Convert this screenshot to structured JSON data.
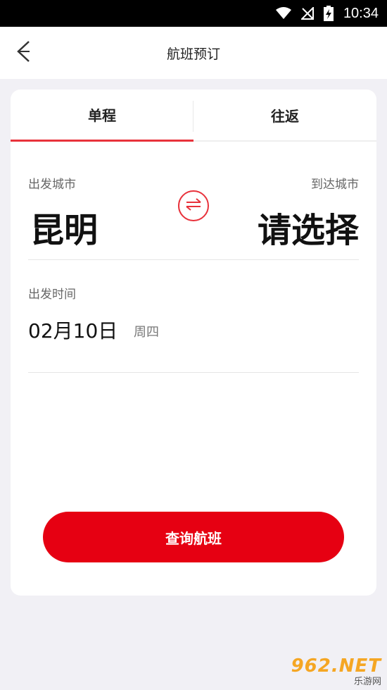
{
  "status_bar": {
    "time": "10:34",
    "icons": [
      "wifi-icon",
      "signal-off-icon",
      "battery-charging-icon"
    ]
  },
  "app_bar": {
    "title": "航班预订",
    "back_icon": "chevron-left-icon"
  },
  "tabs": [
    {
      "label": "单程",
      "active": true
    },
    {
      "label": "往返",
      "active": false
    }
  ],
  "form": {
    "depart_label": "出发城市",
    "depart_city": "昆明",
    "arrive_label": "到达城市",
    "arrive_city": "请选择",
    "swap_icon": "swap-arrows-icon",
    "date_label": "出发时间",
    "date_value": "02月10日",
    "weekday": "周四"
  },
  "search_button": {
    "label": "查询航班"
  },
  "watermark": {
    "text": "962.NET",
    "sub": "乐游网"
  },
  "colors": {
    "accent": "#e60012",
    "tab_underline": "#e8323b",
    "background": "#f1f0f5"
  }
}
